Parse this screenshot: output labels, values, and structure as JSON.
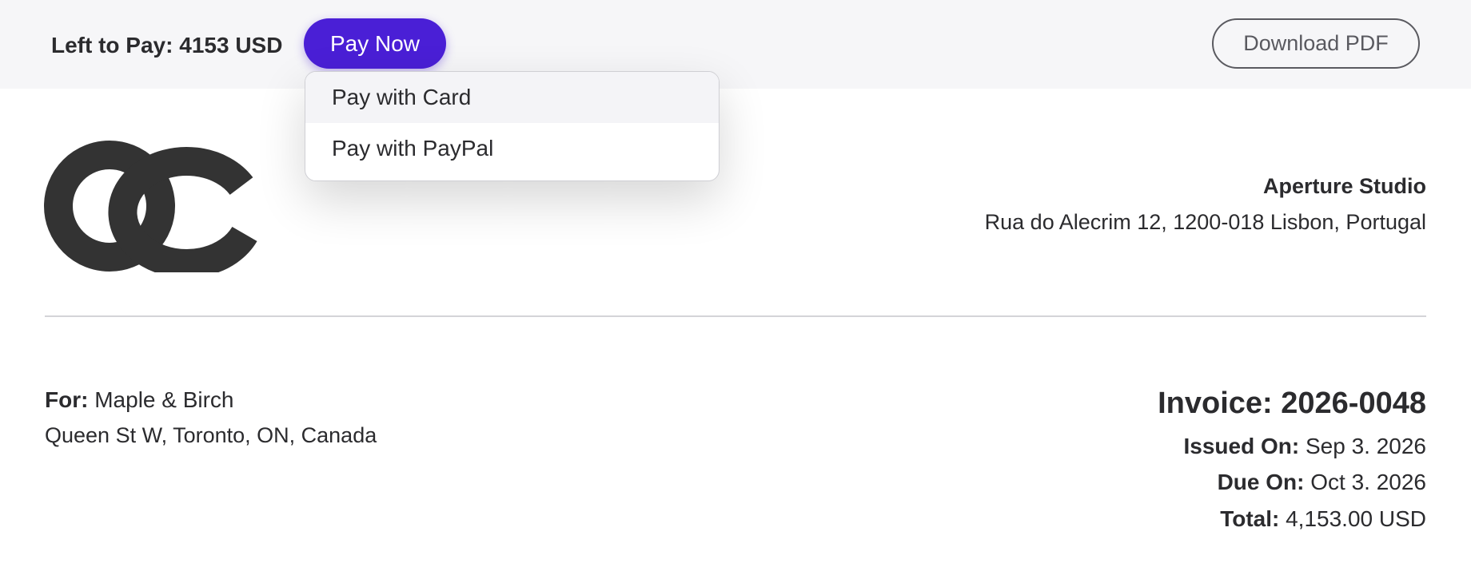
{
  "topbar": {
    "left_to_pay_label": "Left to Pay:",
    "left_to_pay_amount": "4153 USD",
    "pay_now_label": "Pay Now",
    "download_pdf_label": "Download PDF"
  },
  "pay_menu": {
    "items": [
      {
        "label": "Pay with Card"
      },
      {
        "label": "Pay with PayPal"
      }
    ]
  },
  "logo": {
    "icon": "oc-logo-icon"
  },
  "vendor": {
    "name": "Aperture Studio",
    "address": "Rua do Alecrim 12, 1200-018 Lisbon, Portugal"
  },
  "client": {
    "for_label": "For:",
    "name": "Maple & Birch",
    "address": "Queen St W, Toronto, ON, Canada"
  },
  "invoice": {
    "number_label": "Invoice:",
    "number": "2026-0048",
    "issued_label": "Issued On:",
    "issued_value": "Sep 3. 2026",
    "due_label": "Due On:",
    "due_value": "Oct 3. 2026",
    "total_label": "Total:",
    "total_value": "4,153.00 USD"
  },
  "colors": {
    "accent": "#4a1fd6",
    "topbar_bg": "#f6f6f8",
    "text": "#2b2b2e",
    "logo": "#333333"
  }
}
